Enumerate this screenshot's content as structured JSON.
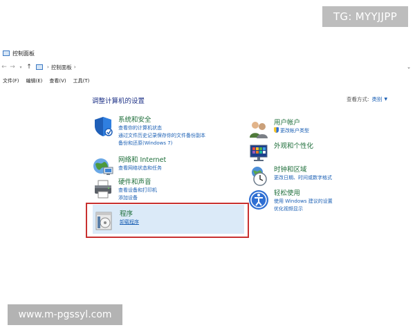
{
  "watermark_top": "TG: MYYJJPP",
  "watermark_bottom": "www.m-pgssyl.com",
  "window": {
    "title": "控制面板"
  },
  "address": {
    "path": "控制面板"
  },
  "menu": [
    "文件(F)",
    "编辑(E)",
    "查看(V)",
    "工具(T)"
  ],
  "heading": "调整计算机的设置",
  "view_by": {
    "label": "查看方式:",
    "value": "类别"
  },
  "categories_left": [
    {
      "title": "系统和安全",
      "icon": "shield-icon",
      "links": [
        "查看你的计算机状态",
        "通过文件历史记录保存你的文件备份副本",
        "备份和还原(Windows 7)"
      ]
    },
    {
      "title": "网络和 Internet",
      "icon": "network-icon",
      "links": [
        "查看网络状态和任务"
      ]
    },
    {
      "title": "硬件和声音",
      "icon": "printer-icon",
      "links": [
        "查看设备和打印机",
        "添加设备"
      ]
    },
    {
      "title": "程序",
      "icon": "programs-icon",
      "links": [
        "卸载程序"
      ]
    }
  ],
  "categories_right": [
    {
      "title": "用户帐户",
      "icon": "users-icon",
      "links": [
        "更改帐户类型"
      ]
    },
    {
      "title": "外观和个性化",
      "icon": "appearance-icon",
      "links": []
    },
    {
      "title": "时钟和区域",
      "icon": "clock-icon",
      "links": [
        "更改日期、时间或数字格式"
      ]
    },
    {
      "title": "轻松使用",
      "icon": "accessibility-icon",
      "links": [
        "使用 Windows 建议的设置",
        "优化视频显示"
      ]
    }
  ],
  "colors": {
    "highlight_fill": "#dbeaf8",
    "highlight_border": "#c8302f",
    "link": "#1a5fb4",
    "category_title": "#1e6e3a"
  }
}
